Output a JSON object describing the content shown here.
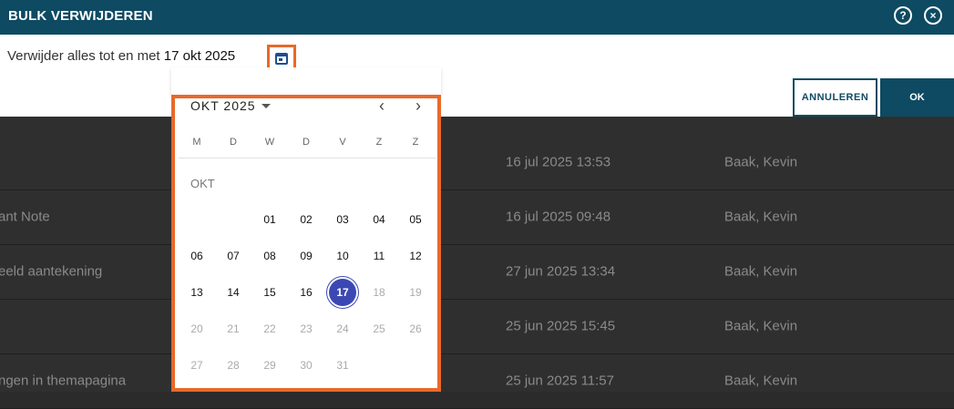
{
  "modal": {
    "title": "BULK VERWIJDEREN",
    "help_icon": "?",
    "close_icon": "×",
    "delete_label": "Verwijder alles tot en met",
    "selected_date": "17 okt 2025",
    "cancel_label": "ANNULEREN",
    "ok_label": "OK"
  },
  "picker": {
    "month_year": "OKT 2025",
    "prev": "‹",
    "next": "›",
    "weekdays": [
      "M",
      "D",
      "W",
      "D",
      "V",
      "Z",
      "Z"
    ],
    "month_label": "OKT",
    "weeks": [
      [
        "",
        "",
        "01",
        "02",
        "03",
        "04",
        "05"
      ],
      [
        "06",
        "07",
        "08",
        "09",
        "10",
        "11",
        "12"
      ],
      [
        "13",
        "14",
        "15",
        "16",
        "17",
        "18",
        "19"
      ],
      [
        "20",
        "21",
        "22",
        "23",
        "24",
        "25",
        "26"
      ],
      [
        "27",
        "28",
        "29",
        "30",
        "31",
        "",
        ""
      ]
    ],
    "selected_day": "17"
  },
  "background_rows": [
    {
      "note": "",
      "date": "16 jul 2025 13:53",
      "user": "Baak, Kevin"
    },
    {
      "note": "ant Note",
      "date": "16 jul 2025 09:48",
      "user": "Baak, Kevin"
    },
    {
      "note": "eeld aantekening",
      "date": "27 jun 2025 13:34",
      "user": "Baak, Kevin"
    },
    {
      "note": "",
      "date": "25 jun 2025 15:45",
      "user": "Baak, Kevin"
    },
    {
      "note": "ngen in themapagina",
      "date": "25 jun 2025 11:57",
      "user": "Baak, Kevin"
    }
  ],
  "colors": {
    "header": "#0e4a62",
    "highlight": "#e8692a",
    "selected_day": "#3b48b3"
  }
}
